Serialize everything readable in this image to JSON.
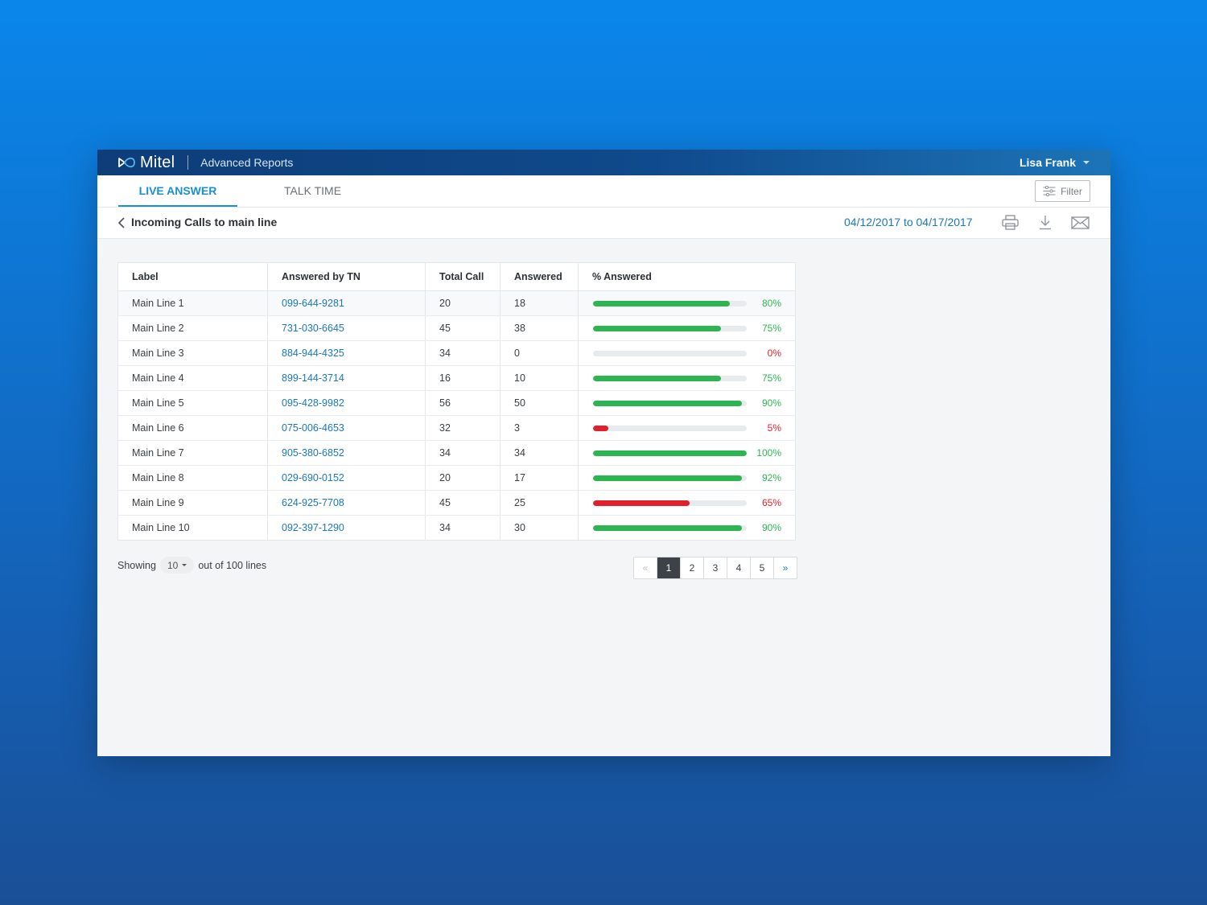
{
  "app": {
    "brand": "Mitel",
    "title": "Advanced Reports",
    "user": "Lisa Frank"
  },
  "tabs": [
    {
      "label": "LIVE ANSWER",
      "active": true
    },
    {
      "label": "TALK TIME",
      "active": false
    }
  ],
  "filter_label": "Filter",
  "subheader": {
    "title": "Incoming Calls to main line",
    "date_range": "04/12/2017 to 04/17/2017"
  },
  "icons": {
    "print": "printer-icon",
    "download": "download-icon",
    "email": "envelope-icon"
  },
  "colors": {
    "accent": "#1b8fcf",
    "good": "#2db552",
    "bad": "#e0212d"
  },
  "table": {
    "columns": [
      "Label",
      "Answered by TN",
      "Total Call",
      "Answered",
      "% Answered"
    ],
    "rows": [
      {
        "label": "Main Line 1",
        "tn": "099-644-9281",
        "total": "20",
        "answered": "18",
        "pct": "80%",
        "value": 0.89,
        "status": "good"
      },
      {
        "label": "Main Line 2",
        "tn": "731-030-6645",
        "total": "45",
        "answered": "38",
        "pct": "75%",
        "value": 0.83,
        "status": "good"
      },
      {
        "label": "Main Line 3",
        "tn": "884-944-4325",
        "total": "34",
        "answered": "0",
        "pct": "0%",
        "value": 0,
        "status": "bad"
      },
      {
        "label": "Main Line 4",
        "tn": "899-144-3714",
        "total": "16",
        "answered": "10",
        "pct": "75%",
        "value": 0.83,
        "status": "good"
      },
      {
        "label": "Main Line 5",
        "tn": "095-428-9982",
        "total": "56",
        "answered": "50",
        "pct": "90%",
        "value": 0.97,
        "status": "good"
      },
      {
        "label": "Main Line 6",
        "tn": "075-006-4653",
        "total": "32",
        "answered": "3",
        "pct": "5%",
        "value": 0.1,
        "status": "bad"
      },
      {
        "label": "Main Line 7",
        "tn": "905-380-6852",
        "total": "34",
        "answered": "34",
        "pct": "100%",
        "value": 1.0,
        "status": "good"
      },
      {
        "label": "Main Line 8",
        "tn": "029-690-0152",
        "total": "20",
        "answered": "17",
        "pct": "92%",
        "value": 0.97,
        "status": "good"
      },
      {
        "label": "Main Line 9",
        "tn": "624-925-7708",
        "total": "45",
        "answered": "25",
        "pct": "65%",
        "value": 0.63,
        "status": "bad"
      },
      {
        "label": "Main Line 10",
        "tn": "092-397-1290",
        "total": "34",
        "answered": "30",
        "pct": "90%",
        "value": 0.97,
        "status": "good"
      }
    ]
  },
  "footer": {
    "showing_label": "Showing",
    "page_size": "10",
    "suffix": "out of 100 lines"
  },
  "pagination": {
    "prev": "«",
    "pages": [
      "1",
      "2",
      "3",
      "4",
      "5"
    ],
    "current": "1",
    "next": "»"
  }
}
